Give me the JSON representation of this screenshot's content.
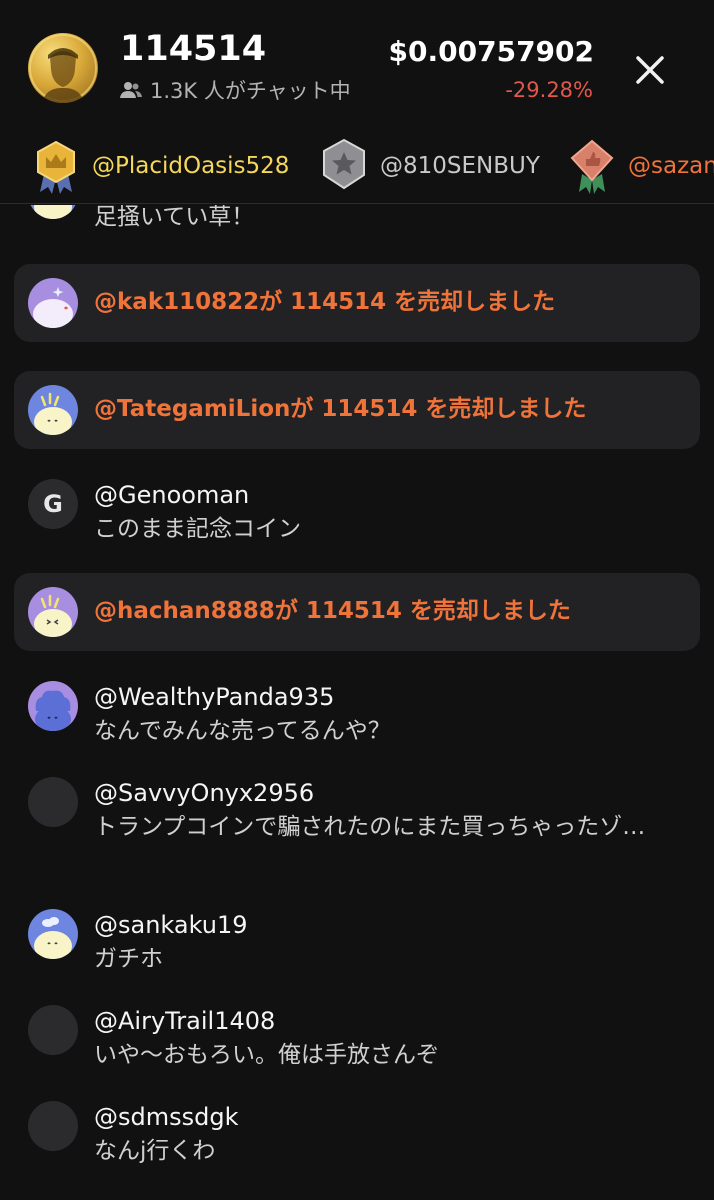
{
  "header": {
    "title": "114514",
    "chat_count": "1.3K 人がチャット中",
    "price": "$0.00757902",
    "change": "-29.28%",
    "change_color": "#e2574c"
  },
  "ranking": [
    {
      "handle": "@PlacidOasis528",
      "medal": "gold-crown-medal",
      "color": "#f5d75a"
    },
    {
      "handle": "@810SENBUY",
      "medal": "silver-star-medal",
      "color": "#c9c9c9"
    },
    {
      "handle": "@sazan",
      "medal": "bronze-thumb-medal",
      "color": "#f0743a"
    }
  ],
  "messages": [
    {
      "type": "comment",
      "text": "足掻いてい草！"
    },
    {
      "type": "sell_event",
      "user": "@kak110822",
      "text": "が 114514 を売却しました"
    },
    {
      "type": "sell_event",
      "user": "@TategamiLion",
      "text": "が 114514 を売却しました"
    },
    {
      "type": "comment",
      "user": "@Genooman",
      "avatar_letter": "G",
      "text": "このまま記念コイン"
    },
    {
      "type": "sell_event",
      "user": "@hachan8888",
      "text": "が 114514 を売却しました"
    },
    {
      "type": "comment",
      "user": "@WealthyPanda935",
      "text": "なんでみんな売ってるんや？"
    },
    {
      "type": "comment",
      "user": "@SavvyOnyx2956",
      "text": "トランプコインで騙されたのにまた買っちゃったゾ…"
    },
    {
      "type": "comment",
      "user": "@sankaku19",
      "text": "ガチホ"
    },
    {
      "type": "comment",
      "user": "@AiryTrail1408",
      "text": "いや〜おもろい。俺は手放さんぞ"
    },
    {
      "type": "comment",
      "user": "@sdmssdgk",
      "text": "なんj行くわ"
    }
  ],
  "colors": {
    "background": "#111112",
    "event_bg": "#222224",
    "event_text": "#f0743a"
  }
}
